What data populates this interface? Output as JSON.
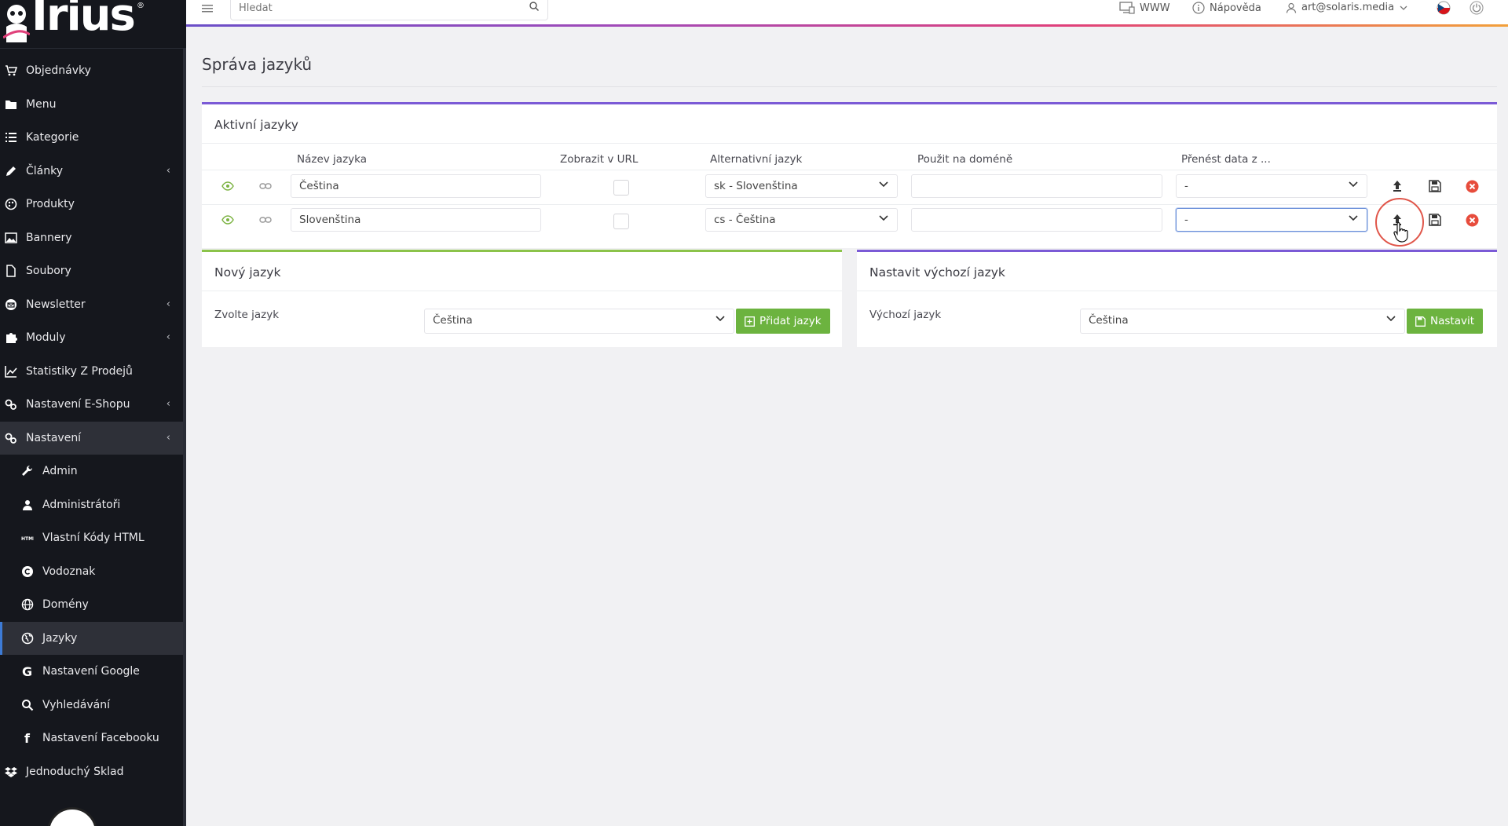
{
  "app": {
    "brand": "Irius",
    "reg_mark": "®"
  },
  "topbar": {
    "search_placeholder": "Hledat",
    "links": {
      "www": "WWW",
      "help": "Nápověda",
      "user": "art@solaris.media"
    }
  },
  "sidebar": {
    "items": [
      {
        "label": "Objednávky",
        "icon": "cart-icon"
      },
      {
        "label": "Menu",
        "icon": "folder-icon"
      },
      {
        "label": "Kategorie",
        "icon": "list-icon"
      },
      {
        "label": "Články",
        "icon": "pencil-icon",
        "expandable": true
      },
      {
        "label": "Produkty",
        "icon": "palette-icon"
      },
      {
        "label": "Bannery",
        "icon": "image-icon"
      },
      {
        "label": "Soubory",
        "icon": "file-icon"
      },
      {
        "label": "Newsletter",
        "icon": "envelope-icon",
        "expandable": true
      },
      {
        "label": "Moduly",
        "icon": "puzzle-icon",
        "expandable": true
      },
      {
        "label": "Statistiky Z Prodejů",
        "icon": "chart-icon"
      },
      {
        "label": "Nastavení E-Shopu",
        "icon": "cogs-icon",
        "expandable": true
      },
      {
        "label": "Nastavení",
        "icon": "cogs-icon",
        "expandable": true
      },
      {
        "label": "Admin",
        "icon": "wrench-icon"
      },
      {
        "label": "Administrátoři",
        "icon": "user-icon"
      },
      {
        "label": "Vlastní Kódy HTML",
        "icon": "html-icon"
      },
      {
        "label": "Vodoznak",
        "icon": "copyright-icon"
      },
      {
        "label": "Domény",
        "icon": "globe-icon"
      },
      {
        "label": "Jazyky",
        "icon": "globe-europe-icon"
      },
      {
        "label": "Nastavení Google",
        "icon": "google-icon"
      },
      {
        "label": "Vyhledávání",
        "icon": "search-icon"
      },
      {
        "label": "Nastavení Facebooku",
        "icon": "facebook-icon"
      },
      {
        "label": "Jednoduchý Sklad",
        "icon": "dropbox-icon"
      }
    ]
  },
  "page": {
    "title": "Správa jazyků"
  },
  "active_languages": {
    "header": "Aktivní jazyky",
    "columns": {
      "name": "Název jazyka",
      "url": "Zobrazit v URL",
      "alt": "Alternativní jazyk",
      "domain": "Použit na doméně",
      "transfer": "Přenést data z ..."
    },
    "rows": [
      {
        "name": "Čeština",
        "alt": "sk - Slovenština",
        "domain": "",
        "transfer": "-"
      },
      {
        "name": "Slovenština",
        "alt": "cs - Čeština",
        "domain": "",
        "transfer": "-"
      }
    ]
  },
  "new_language": {
    "header": "Nový jazyk",
    "label": "Zvolte jazyk",
    "selected": "Čeština",
    "button": "Přidat jazyk"
  },
  "default_language": {
    "header": "Nastavit výchozí jazyk",
    "label": "Výchozí jazyk",
    "selected": "Čeština",
    "button": "Nastavit"
  },
  "colors": {
    "sidebar_bg": "#15171d",
    "accent_purple": "#7b5ad6",
    "accent_green": "#8bc34a",
    "button_green": "#6cb33f",
    "delete_red": "#e74c3c",
    "eye_green": "#7cb342"
  }
}
